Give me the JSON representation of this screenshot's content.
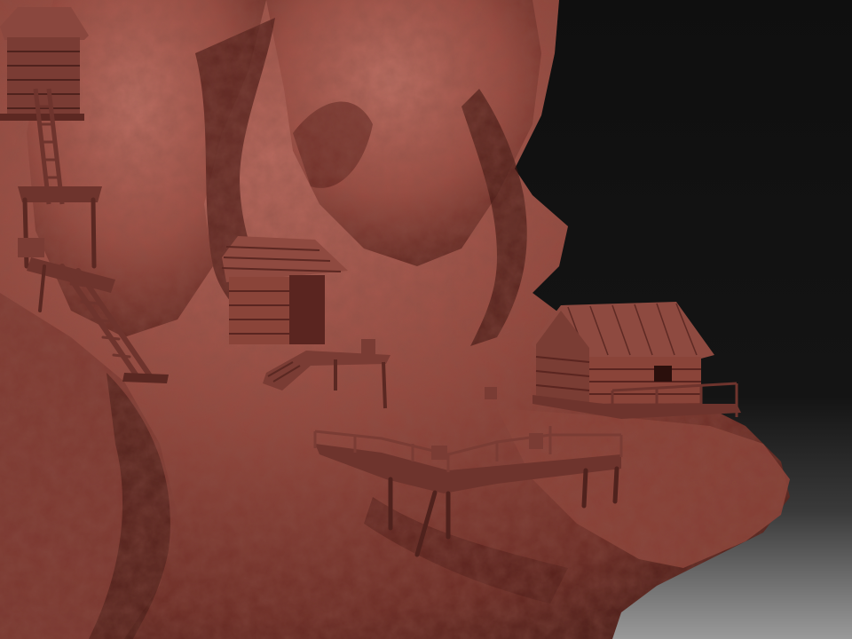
{
  "scene": {
    "type": "3d-sculpt-render",
    "material": "clay",
    "colors": {
      "background_top": "#0f0f0f",
      "background_bottom": "#8a8a8a",
      "rock_light": "#b5645a",
      "rock_mid": "#8f453d",
      "rock_dark": "#4a1c18",
      "wood_light": "#9c554b",
      "wood_mid": "#7a3c34",
      "wood_dark": "#4f221d"
    }
  }
}
